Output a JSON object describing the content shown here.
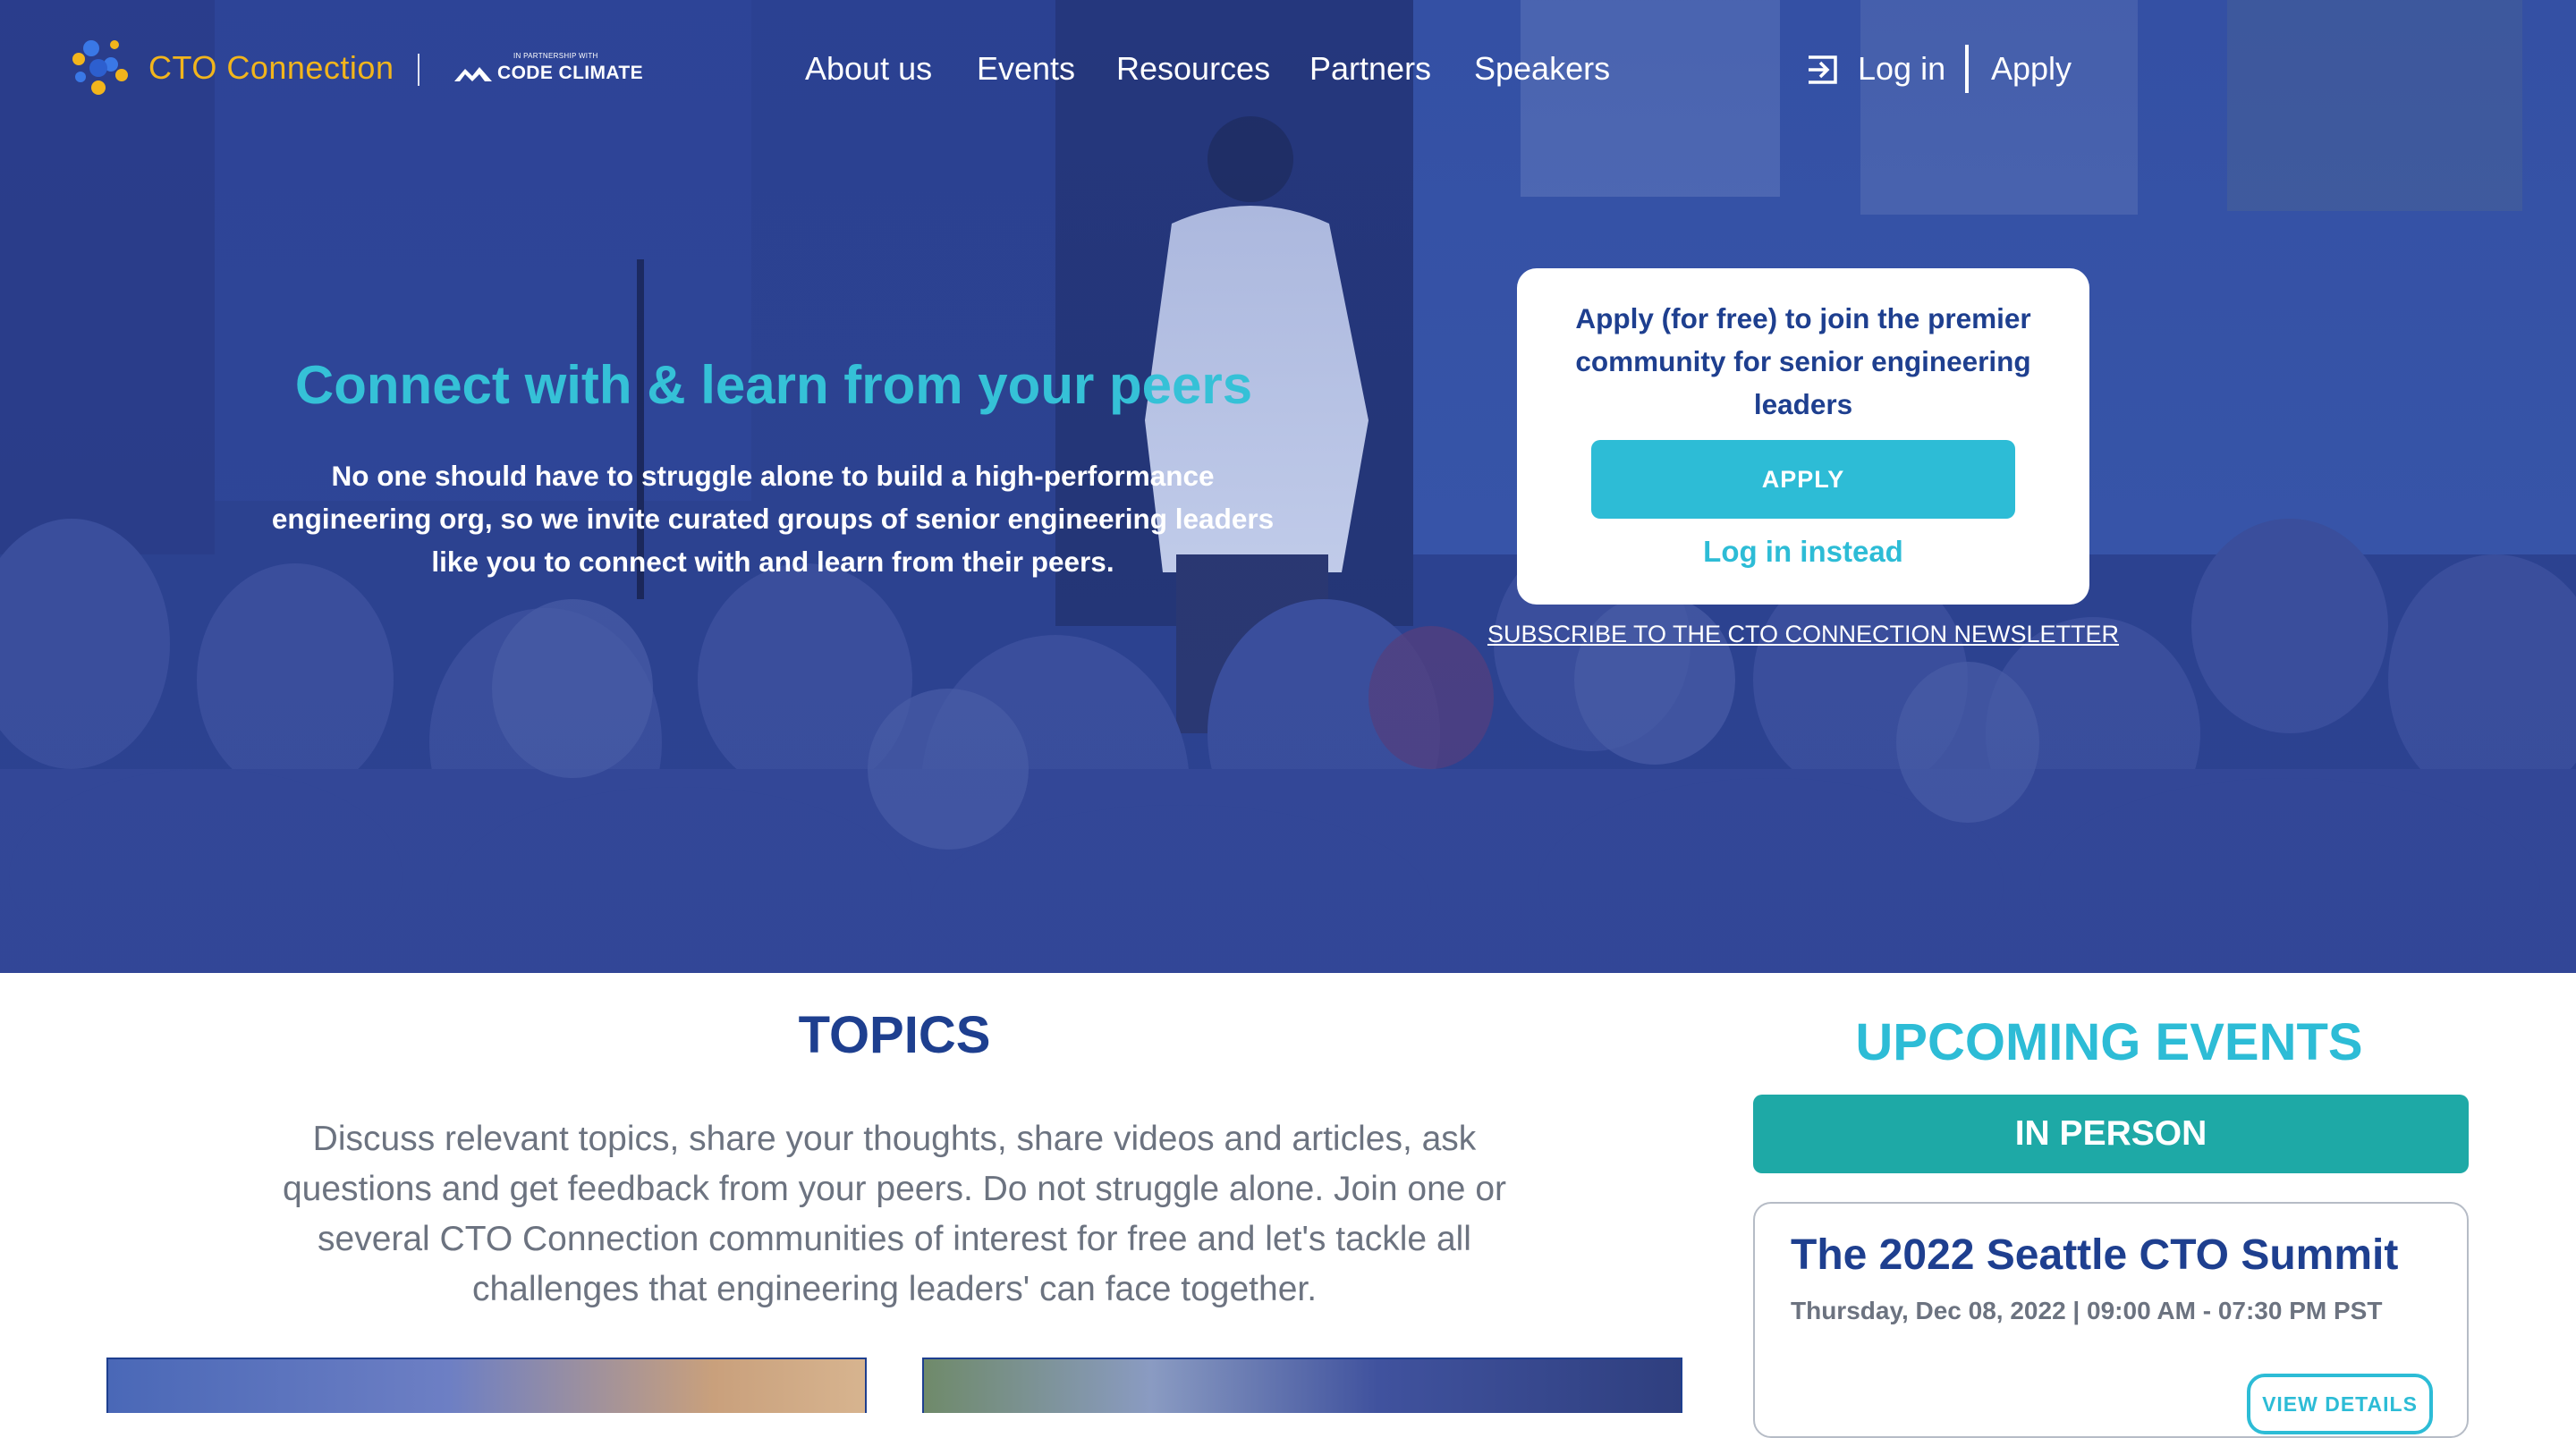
{
  "brand": {
    "name": "CTO Connection",
    "partner_small": "IN PARTNERSHIP WITH",
    "partner_name": "CODE CLIMATE",
    "primary_color": "#1e3f8f",
    "accent_color": "#2dbcd6",
    "logo_color": "#f2b51c",
    "teal": "#1ea9a6"
  },
  "nav": {
    "items": [
      "About us",
      "Events",
      "Resources",
      "Partners",
      "Speakers"
    ],
    "login_label": "Log in",
    "login_icon": "login-icon",
    "apply_label": "Apply"
  },
  "hero": {
    "title": "Connect with & learn from your peers",
    "description": "No one should have to struggle alone to build a high-performance engineering org, so we invite curated groups of senior engineering leaders like you to connect with and learn from their peers."
  },
  "apply_card": {
    "text": "Apply (for free) to join the premier community for senior engineering leaders",
    "button": "APPLY",
    "login_instead": "Log in instead"
  },
  "subscribe": "SUBSCRIBE TO THE CTO CONNECTION NEWSLETTER",
  "topics": {
    "title": "TOPICS",
    "description": "Discuss relevant topics, share your thoughts, share videos and articles, ask questions and get feedback from your peers. Do not struggle alone. Join one or several CTO Connection communities of interest for free and let's tackle all challenges that engineering leaders' can face together."
  },
  "events": {
    "title": "UPCOMING EVENTS",
    "filter": "IN PERSON",
    "card": {
      "title": "The 2022 Seattle CTO Summit",
      "date": "Thursday, Dec 08, 2022 | 09:00 AM - 07:30 PM PST",
      "button": "VIEW DETAILS"
    }
  }
}
